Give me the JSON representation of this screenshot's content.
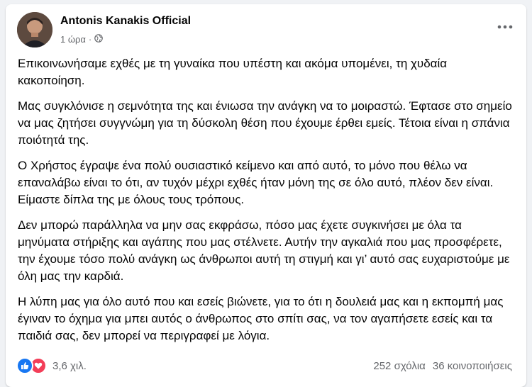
{
  "post": {
    "author": "Antonis Kanakis Official",
    "time": "1 ώρα",
    "audience_icon": "globe-icon",
    "menu_icon": "more-horizontal-icon",
    "paragraphs": [
      "Επικοινωνήσαμε εχθές με τη γυναίκα που υπέστη και ακόμα υπομένει, τη χυδαία κακοποίηση.",
      "Μας συγκλόνισε η σεμνότητα της και ένιωσα την ανάγκη να το μοιραστώ. Έφτασε στο σημείο να μας ζητήσει συγγνώμη για τη δύσκολη θέση που έχουμε έρθει εμείς. Τέτοια είναι η σπάνια ποιότητά της.",
      "Ο Χρήστος έγραψε ένα πολύ ουσιαστικό κείμενο και από αυτό, το μόνο που θέλω να επαναλάβω είναι το ότι, αν τυχόν μέχρι εχθές ήταν μόνη της σε όλο αυτό, πλέον δεν είναι. Είμαστε δίπλα της με όλους τους τρόπους.",
      "Δεν μπορώ παράλληλα να μην σας εκφράσω, πόσο μας έχετε συγκινήσει με όλα τα μηνύματα στήριξης και αγάπης που μας στέλνετε. Αυτήν την αγκαλιά που μας προσφέρετε, την έχουμε τόσο πολύ ανάγκη ως άνθρωποι αυτή τη στιγμή και γι’ αυτό σας ευχαριστούμε με όλη μας την καρδιά.",
      "Η λύπη μας για όλο αυτό που και εσείς βιώνετε, για το ότι η δουλειά μας και η εκπομπή μας έγιναν το όχημα για μπει αυτός ο άνθρωπος στο σπίτι σας, να τον αγαπήσετε εσείς και τα παιδιά σας, δεν μπορεί να περιγραφεί με λόγια."
    ]
  },
  "footer": {
    "reaction_icons": [
      "like-icon",
      "love-icon"
    ],
    "reaction_count": "3,6 χιλ.",
    "comments": "252 σχόλια",
    "shares": "36 κοινοποιήσεις"
  },
  "colors": {
    "like": "#1877f2",
    "love": "#f33e58",
    "secondary_text": "#65676b"
  }
}
